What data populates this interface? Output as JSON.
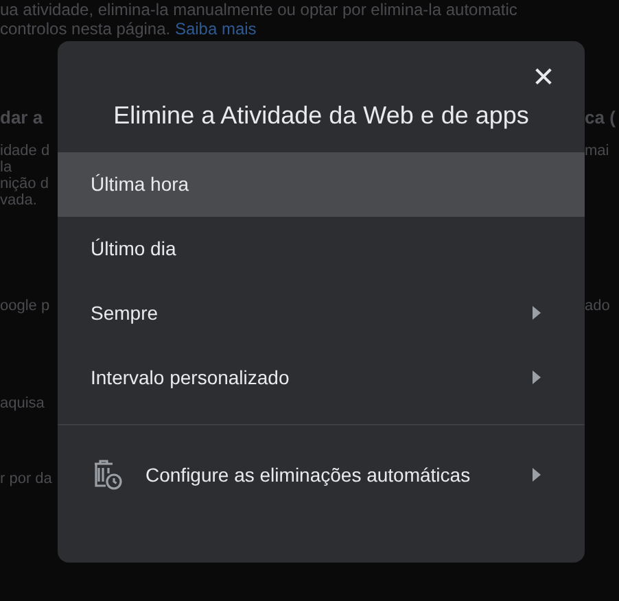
{
  "page": {
    "intro_lines": [
      "ua atividade, elimina-la manualmente ou optar por elimina-la automatic",
      "controlos nesta página."
    ],
    "learn_more": "Saiba mais",
    "left_groups": [
      {
        "kind": "heading",
        "lines": [
          "dar a"
        ]
      },
      {
        "kind": "body",
        "lines": [
          "idade d",
          "la",
          "nição d",
          "vada."
        ]
      },
      {
        "kind": "body",
        "lines": [
          "oogle p"
        ]
      },
      {
        "kind": "body",
        "lines": [
          "aquisa"
        ]
      },
      {
        "kind": "body",
        "lines": [
          "r por da"
        ]
      }
    ],
    "right_groups": [
      {
        "kind": "heading",
        "lines": [
          "ca ("
        ]
      },
      {
        "kind": "body",
        "lines": [
          "mai"
        ]
      },
      {
        "kind": "body",
        "lines": [
          "ado"
        ]
      }
    ]
  },
  "dialog": {
    "title": "Elimine a Atividade da Web e de apps",
    "close": "✕",
    "options": [
      {
        "label": "Última hora",
        "selected": true,
        "has_submenu": false
      },
      {
        "label": "Último dia",
        "selected": false,
        "has_submenu": false
      },
      {
        "label": "Sempre",
        "selected": false,
        "has_submenu": true
      },
      {
        "label": "Intervalo personalizado",
        "selected": false,
        "has_submenu": true
      }
    ],
    "auto_delete": {
      "label": "Configure as eliminações automáticas",
      "has_submenu": true
    }
  }
}
